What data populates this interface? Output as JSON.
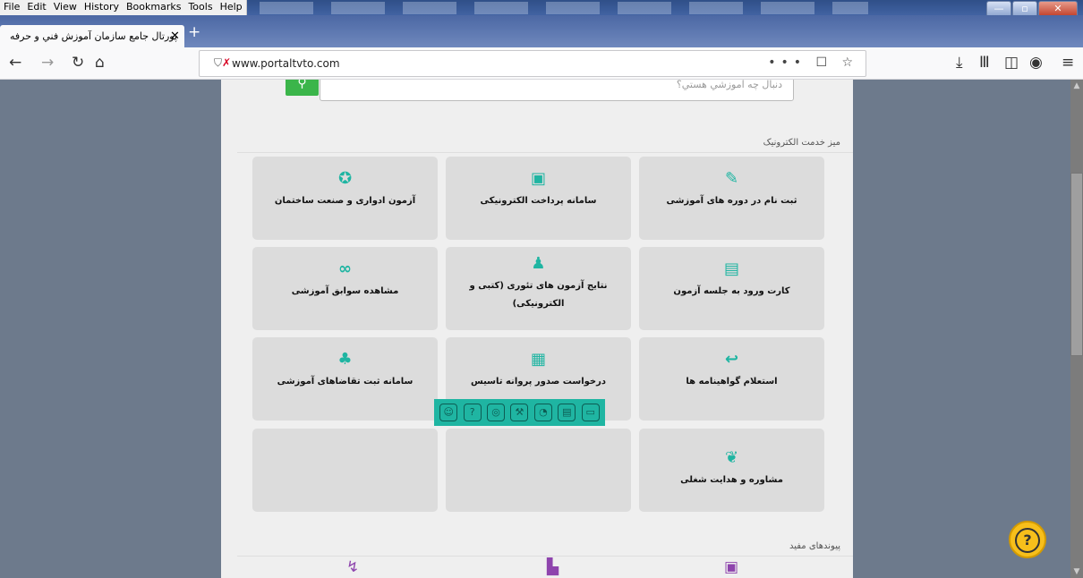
{
  "menu": [
    "File",
    "Edit",
    "View",
    "History",
    "Bookmarks",
    "Tools",
    "Help"
  ],
  "window_controls": [
    "minimize",
    "maximize",
    "close"
  ],
  "tab": {
    "title": "پورتال جامع سازمان آموزش فني و حرفه",
    "close": "✕",
    "new_tab": "+"
  },
  "nav": {
    "back": "←",
    "forward": "→",
    "reload": "↻",
    "home": "⌂"
  },
  "url": "www.portaltvto.com",
  "urlbar_right": "••• ☐ ☆",
  "toolbar_right": [
    "download-icon",
    "library-icon",
    "sidebar-icon",
    "account-icon",
    "menu-icon"
  ],
  "search": {
    "placeholder": "دنبال چه آموزشي هستي؟",
    "button_icon": "search-icon"
  },
  "services_title": "ميز خدمت الكترونيک",
  "services": [
    {
      "label": "ثبت نام در دوره های آموزشی",
      "icon": "edit-icon",
      "glyph": "✎"
    },
    {
      "label": "سامانه پرداخت الکترونیکی",
      "icon": "money-icon",
      "glyph": "▣"
    },
    {
      "label": "آزمون ادواری و صنعت ساختمان",
      "icon": "award-icon",
      "glyph": "✪"
    },
    {
      "label": "کارت ورود به جلسه آزمون",
      "icon": "id-card-icon",
      "glyph": "▤"
    },
    {
      "label": "نتایج آزمون های تئوری (کتبی و الکترونیکی)",
      "icon": "graduate-icon",
      "glyph": "♟"
    },
    {
      "label": "مشاهده سوابق آموزشی",
      "icon": "glasses-icon",
      "glyph": "∞"
    },
    {
      "label": "استعلام گواهینامه ها",
      "icon": "reply-all-icon",
      "glyph": "↩"
    },
    {
      "label": "درخواست صدور پروانه تاسیس",
      "icon": "building-icon",
      "glyph": "▦"
    },
    {
      "label": "سامانه ثبت تقاضاهای آموزشی",
      "icon": "tree-icon",
      "glyph": "♣"
    },
    {
      "label": "مشاوره و هدایت شغلی",
      "icon": "hands-icon",
      "glyph": "❦"
    },
    {
      "label": "",
      "icon": "",
      "glyph": ""
    },
    {
      "label": "",
      "icon": "",
      "glyph": ""
    }
  ],
  "float_toolbar": [
    "face-icon",
    "question-icon",
    "user-icon",
    "gavel-icon",
    "stopwatch-icon",
    "document-icon",
    "cash-icon"
  ],
  "links_title": "پیوندهای مفید",
  "help_label": "?",
  "colors": {
    "accent": "#1fb5a2",
    "search_button": "#3bb54a",
    "help": "#f7bf1b"
  }
}
